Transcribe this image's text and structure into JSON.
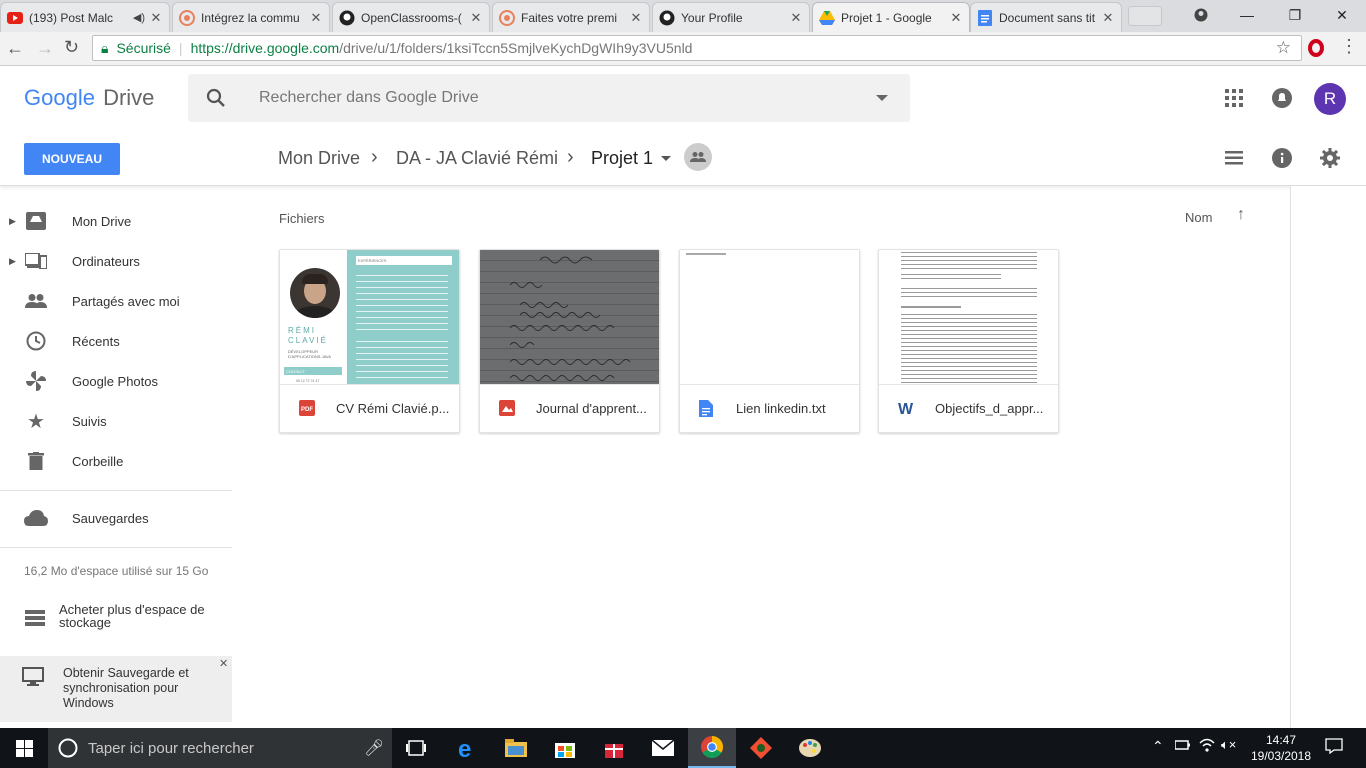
{
  "browser": {
    "tabs": [
      {
        "title": "(193) Post Malc",
        "icon": "youtube-icon",
        "color": "#e62117"
      },
      {
        "title": "Intégrez la commu",
        "icon": "openclassrooms-icon",
        "color": "#e8805e"
      },
      {
        "title": "OpenClassrooms-(",
        "icon": "github-icon",
        "color": "#222222"
      },
      {
        "title": "Faites votre premi",
        "icon": "openclassrooms-icon",
        "color": "#e8805e"
      },
      {
        "title": "Your Profile",
        "icon": "github-icon",
        "color": "#222222"
      },
      {
        "title": "Projet 1 - Google",
        "icon": "drive-icon",
        "color": "#1fa463"
      },
      {
        "title": "Document sans tit",
        "icon": "docs-icon",
        "color": "#4285f4"
      }
    ],
    "secure_label": "Sécurisé",
    "url_main": "https://drive.google.com",
    "url_path": "/drive/u/1/folders/1ksiTccn5SmjlveKychDgWIh9y3VU5nld"
  },
  "drive": {
    "logo_google": "Google",
    "logo_drive": "Drive",
    "search_placeholder": "Rechercher dans Google Drive",
    "avatar_letter": "R",
    "new_button": "NOUVEAU",
    "breadcrumb": [
      "Mon Drive",
      "DA - JA Clavié Rémi",
      "Projet 1"
    ],
    "section_title": "Fichiers",
    "sort_label": "Nom"
  },
  "sidebar": {
    "items": [
      {
        "label": "Mon Drive",
        "icon": "my-drive-icon"
      },
      {
        "label": "Ordinateurs",
        "icon": "computers-icon"
      },
      {
        "label": "Partagés avec moi",
        "icon": "shared-icon"
      },
      {
        "label": "Récents",
        "icon": "recent-icon"
      },
      {
        "label": "Google Photos",
        "icon": "photos-icon"
      },
      {
        "label": "Suivis",
        "icon": "star-icon"
      },
      {
        "label": "Corbeille",
        "icon": "trash-icon"
      }
    ],
    "backups": "Sauvegardes",
    "storage": "16,2 Mo d'espace utilisé sur 15 Go",
    "buy_storage": "Acheter plus d'espace de stockage",
    "backup_promo": "Obtenir Sauvegarde et synchronisation pour Windows"
  },
  "files": [
    {
      "name": "CV Rémi Clavié.p...",
      "type": "pdf",
      "icon_color": "#db4437"
    },
    {
      "name": "Journal d'apprent...",
      "type": "image",
      "icon_color": "#db4437"
    },
    {
      "name": "Lien linkedin.txt",
      "type": "text",
      "icon_color": "#4285f4"
    },
    {
      "name": "Objectifs_d_appr...",
      "type": "word",
      "icon_color": "#2a5699"
    }
  ],
  "cv_thumb": {
    "name_first": "RÉMI",
    "name_last": "CLAVIÉ",
    "role": "DÉVELOPPEUR D'APPLICATIONS JAVA",
    "section_exp": "EXPÉRIENCES",
    "section_contact": "CONTACT",
    "phone": "06 12 72 74 47"
  },
  "taskbar": {
    "search_placeholder": "Taper ici pour rechercher",
    "time": "14:47",
    "date": "19/03/2018"
  }
}
